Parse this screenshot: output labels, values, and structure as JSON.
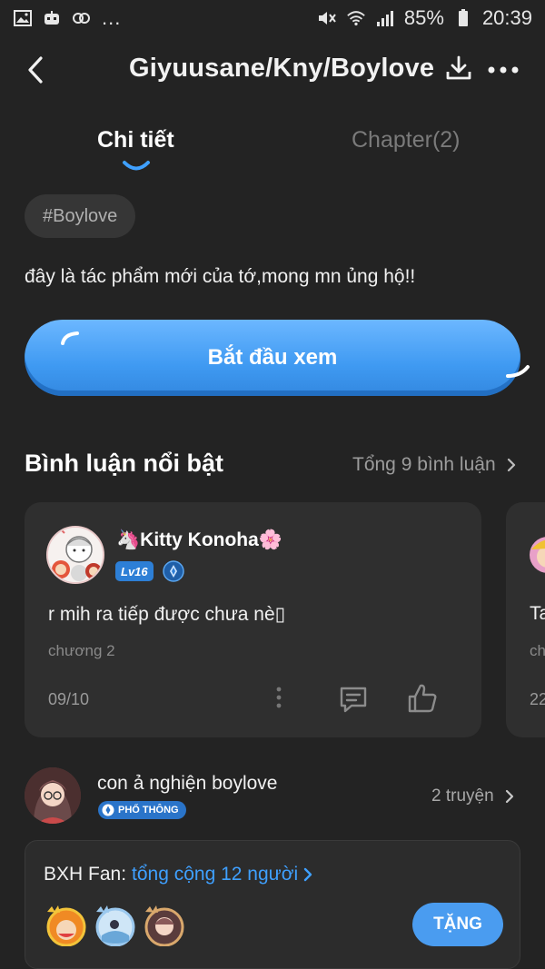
{
  "status_bar": {
    "battery": "85%",
    "time": "20:39",
    "dots": "..."
  },
  "header": {
    "title": "Giyuusane/Kny/Boylove"
  },
  "tabs": [
    {
      "label": "Chi tiết",
      "active": true
    },
    {
      "label": "Chapter(2)",
      "active": false
    }
  ],
  "detail": {
    "tag": "#Boylove",
    "description": "đây là tác phẩm mới của tớ,mong mn ủng hộ!!",
    "start_button": "Bắt đầu xem"
  },
  "comments": {
    "section_title": "Bình luận nổi bật",
    "total": "Tổng 9 bình luận",
    "items": [
      {
        "username": "🦄Kitty Konoha🌸",
        "level": "Lv16",
        "text": "r mih ra tiếp được chưa nè▯",
        "chapter": "chương 2",
        "date": "09/10"
      }
    ],
    "peek": {
      "text": "Ta",
      "chapter": "ch",
      "date": "22"
    }
  },
  "author": {
    "name": "con ả nghiện boylove",
    "badge": "PHỔ THÔNG",
    "stories": "2 truyện"
  },
  "fans": {
    "title": "BXH Fan:",
    "link": "tổng cộng 12 người",
    "gift_button": "TẶNG"
  },
  "colors": {
    "background": "#232323",
    "accent": "#3fa0ff",
    "card": "#2f2f2f"
  }
}
